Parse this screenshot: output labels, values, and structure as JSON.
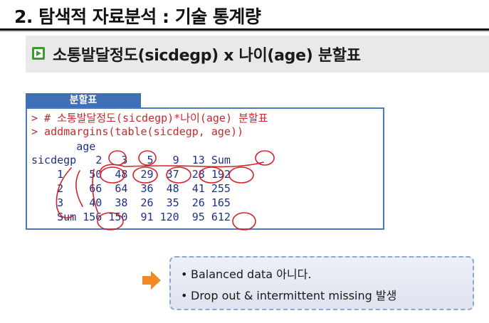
{
  "title": "2. 탐색적 자료분석 : 기술 통계량",
  "subheading": "소통발달정도(sicdegp) x 나이(age) 분할표",
  "code_panel": {
    "tab_label": "분할표",
    "lines": [
      "> # 소통발달정도(sicdegp)*나이(age) 분할표",
      "> addmargins(table(sicdegp, age))",
      "       age",
      "sicdegp   2   3   5   9  13 Sum",
      "    1    50  48  29  37  28 192",
      "    2    66  64  36  48  41 255",
      "    3    40  38  26  35  26 165",
      "    Sum 156 150  91 120  95 612"
    ]
  },
  "notes": [
    "Balanced data 아니다.",
    "Drop out & intermittent missing 발생"
  ],
  "bullet": "•",
  "colors": {
    "accent_blue": "#3f6fb5",
    "prompt_red": "#c8282e",
    "output_blue": "#1e2f8a",
    "arrow_orange": "#f08a24",
    "bullet_green": "#3c9c31"
  }
}
